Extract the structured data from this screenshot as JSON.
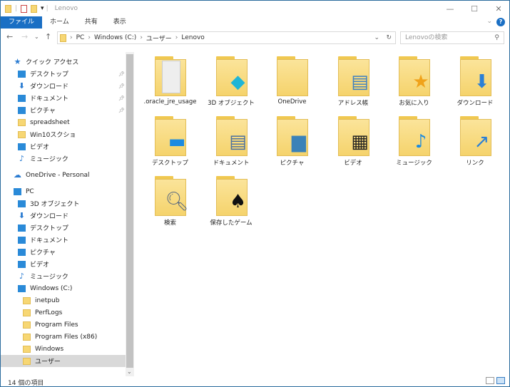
{
  "window": {
    "title": "Lenovo",
    "minimize": "—",
    "maximize": "☐",
    "close": "✕"
  },
  "ribbon": {
    "tabs": [
      "ファイル",
      "ホーム",
      "共有",
      "表示"
    ],
    "help": "?",
    "expand": "⌄"
  },
  "nav": {
    "back": "←",
    "forward": "→",
    "recent": "⌄",
    "up": "↑",
    "refresh": "↻",
    "dropdown": "⌄",
    "breadcrumb": [
      "PC",
      "Windows (C:)",
      "ユーザー",
      "Lenovo"
    ],
    "search_placeholder": "Lenovoの検索"
  },
  "sidebar": {
    "items": [
      {
        "label": "クイック アクセス",
        "icon": "star-icon",
        "indent": 0,
        "pinned": false
      },
      {
        "label": "デスクトップ",
        "icon": "desktop-icon",
        "indent": 1,
        "pinned": true
      },
      {
        "label": "ダウンロード",
        "icon": "download-icon",
        "indent": 1,
        "pinned": true
      },
      {
        "label": "ドキュメント",
        "icon": "document-icon",
        "indent": 1,
        "pinned": true
      },
      {
        "label": "ピクチャ",
        "icon": "pictures-icon",
        "indent": 1,
        "pinned": true
      },
      {
        "label": "spreadsheet",
        "icon": "folder-icon",
        "indent": 1,
        "pinned": false
      },
      {
        "label": "Win10スクショ",
        "icon": "folder-icon",
        "indent": 1,
        "pinned": false
      },
      {
        "label": "ビデオ",
        "icon": "video-icon",
        "indent": 1,
        "pinned": false
      },
      {
        "label": "ミュージック",
        "icon": "music-icon",
        "indent": 1,
        "pinned": false
      },
      {
        "label": "OneDrive - Personal",
        "icon": "cloud-icon",
        "indent": 0,
        "pinned": false,
        "gap": true
      },
      {
        "label": "PC",
        "icon": "pc-icon",
        "indent": 0,
        "pinned": false,
        "gap": true
      },
      {
        "label": "3D オブジェクト",
        "icon": "3d-objects-icon",
        "indent": 1,
        "pinned": false
      },
      {
        "label": "ダウンロード",
        "icon": "download-icon",
        "indent": 1,
        "pinned": false
      },
      {
        "label": "デスクトップ",
        "icon": "desktop-icon",
        "indent": 1,
        "pinned": false
      },
      {
        "label": "ドキュメント",
        "icon": "document-icon",
        "indent": 1,
        "pinned": false
      },
      {
        "label": "ピクチャ",
        "icon": "pictures-icon",
        "indent": 1,
        "pinned": false
      },
      {
        "label": "ビデオ",
        "icon": "video-icon",
        "indent": 1,
        "pinned": false
      },
      {
        "label": "ミュージック",
        "icon": "music-icon",
        "indent": 1,
        "pinned": false
      },
      {
        "label": "Windows (C:)",
        "icon": "drive-icon",
        "indent": 1,
        "pinned": false
      },
      {
        "label": "inetpub",
        "icon": "folder-icon",
        "indent": 2,
        "pinned": false
      },
      {
        "label": "PerfLogs",
        "icon": "folder-icon",
        "indent": 2,
        "pinned": false
      },
      {
        "label": "Program Files",
        "icon": "folder-icon",
        "indent": 2,
        "pinned": false
      },
      {
        "label": "Program Files (x86)",
        "icon": "folder-icon",
        "indent": 2,
        "pinned": false
      },
      {
        "label": "Windows",
        "icon": "folder-icon",
        "indent": 2,
        "pinned": false
      },
      {
        "label": "ユーザー",
        "icon": "folder-icon",
        "indent": 2,
        "pinned": false,
        "selected": true
      }
    ]
  },
  "items": [
    {
      "label": ".oracle_jre_usage",
      "icon": "file-folder-icon",
      "glyph": "",
      "color": "#eee"
    },
    {
      "label": "3D オブジェクト",
      "icon": "3d-cube-icon",
      "glyph": "◆",
      "color": "#1fb5d6"
    },
    {
      "label": "OneDrive",
      "icon": "folder-icon",
      "glyph": "",
      "color": ""
    },
    {
      "label": "アドレス帳",
      "icon": "contacts-icon",
      "glyph": "▤",
      "color": "#3d7fc1"
    },
    {
      "label": "お気に入り",
      "icon": "star-icon",
      "glyph": "★",
      "color": "#f0a21a"
    },
    {
      "label": "ダウンロード",
      "icon": "download-icon",
      "glyph": "⬇",
      "color": "#2a7fd6"
    },
    {
      "label": "デスクトップ",
      "icon": "desktop-icon",
      "glyph": "▬",
      "color": "#1d8be0"
    },
    {
      "label": "ドキュメント",
      "icon": "document-icon",
      "glyph": "▤",
      "color": "#4a6fa0"
    },
    {
      "label": "ピクチャ",
      "icon": "picture-icon",
      "glyph": "▆",
      "color": "#3b82b8"
    },
    {
      "label": "ビデオ",
      "icon": "film-icon",
      "glyph": "▦",
      "color": "#222"
    },
    {
      "label": "ミュージック",
      "icon": "music-note-icon",
      "glyph": "♪",
      "color": "#1a8ae0"
    },
    {
      "label": "リンク",
      "icon": "link-arrow-icon",
      "glyph": "↗",
      "color": "#2a7fd6"
    },
    {
      "label": "検索",
      "icon": "magnifier-icon",
      "glyph": "🔍︎",
      "color": "#5a6a80"
    },
    {
      "label": "保存したゲーム",
      "icon": "chess-piece-icon",
      "glyph": "♠",
      "color": "#111"
    }
  ],
  "status": {
    "count": "14 個の項目"
  }
}
